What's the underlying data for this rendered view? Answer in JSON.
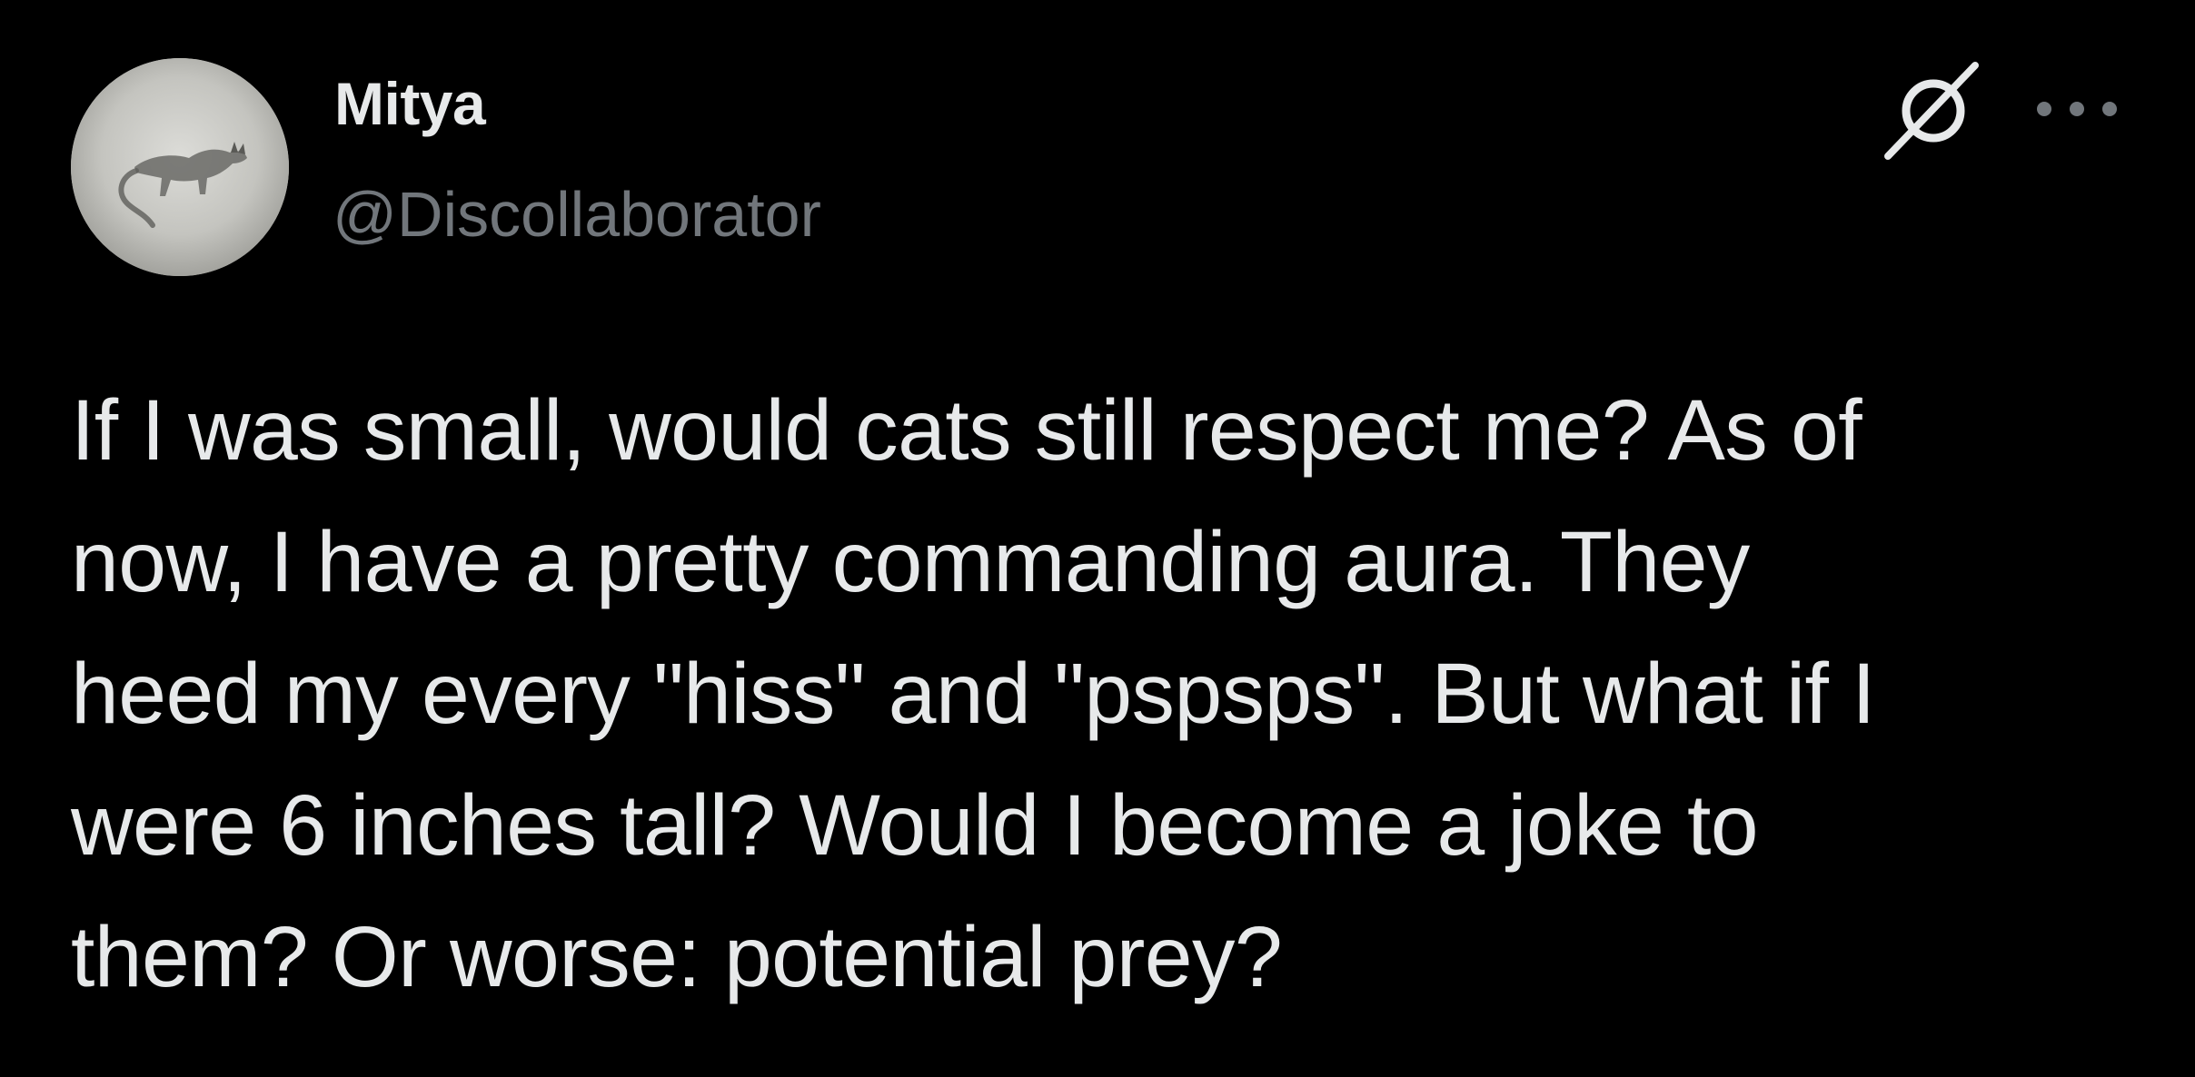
{
  "author": {
    "display_name": "Mitya",
    "handle": "@Discollaborator",
    "avatar_icon": "avatar-cat-photo"
  },
  "header_icons": {
    "grok": "grok-icon",
    "more": "more-options-icon"
  },
  "tweet": {
    "text": "If I was small, would cats still respect me? As of\nnow, I have a pretty commanding aura. They\nheed my every \"hiss\" and \"pspsps\". But what if I\nwere 6 inches tall? Would I become a joke to\nthem? Or worse: potential prey?"
  },
  "colors": {
    "background": "#000000",
    "text_primary": "#e7e9ea",
    "text_secondary": "#71767b"
  }
}
